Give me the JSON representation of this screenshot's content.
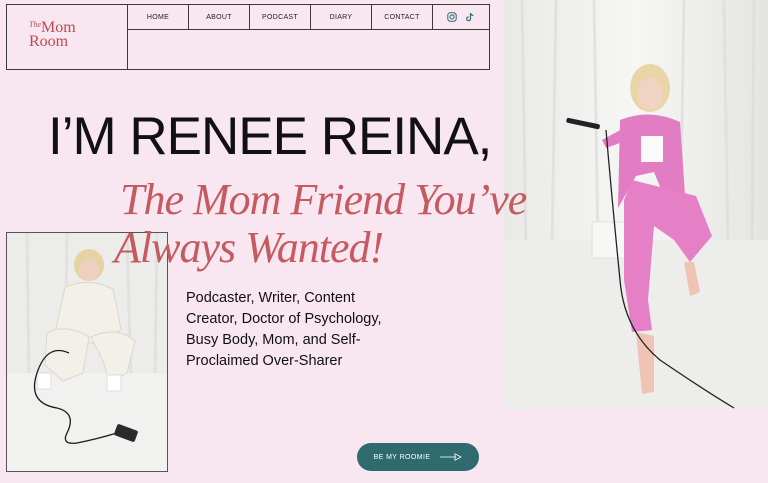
{
  "brand": {
    "the": "The",
    "mom": "Mom",
    "room": "Room",
    "color": "#c0494f"
  },
  "nav": {
    "items": [
      "HOME",
      "ABOUT",
      "PODCAST",
      "DIARY",
      "CONTACT"
    ],
    "social": [
      "instagram-icon",
      "tiktok-icon"
    ]
  },
  "hero": {
    "title": "I’M RENEE REINA,",
    "script_line1": "The Mom Friend You’ve",
    "script_line2": "Always Wanted!",
    "description": "Podcaster, Writer, Content Creator, Doctor of Psychology, Busy Body, Mom, and Self-Proclaimed Over-Sharer"
  },
  "cta": {
    "label": "BE MY ROOMIE",
    "color": "#2e6a6e"
  },
  "colors": {
    "background": "#f8e6f1",
    "accent": "#c55a60",
    "suit": "#e27cc3"
  }
}
